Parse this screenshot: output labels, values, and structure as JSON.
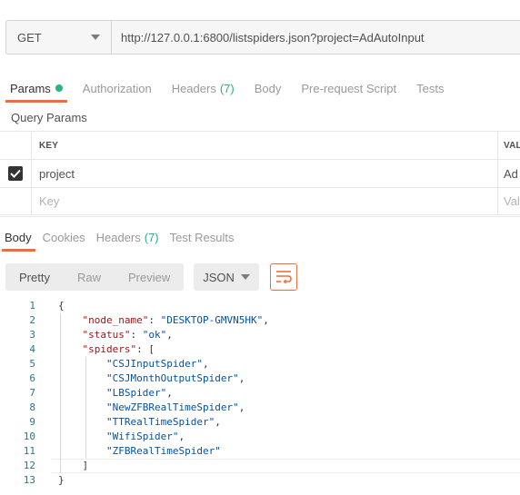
{
  "request": {
    "method": "GET",
    "url": "http://127.0.0.1:6800/listspiders.json?project=AdAutoInput"
  },
  "request_tabs": [
    {
      "label": "Params",
      "active": true,
      "dot": true
    },
    {
      "label": "Authorization"
    },
    {
      "label": "Headers",
      "count": "(7)"
    },
    {
      "label": "Body"
    },
    {
      "label": "Pre-request Script"
    },
    {
      "label": "Tests"
    }
  ],
  "query_params": {
    "title": "Query Params",
    "headers": {
      "key": "KEY",
      "value": "VAL"
    },
    "rows": [
      {
        "checked": true,
        "key": "project",
        "value": "Ad"
      }
    ],
    "placeholder": {
      "key": "Key",
      "value": "Val"
    }
  },
  "response_tabs": [
    {
      "label": "Body",
      "active": true
    },
    {
      "label": "Cookies"
    },
    {
      "label": "Headers",
      "count": "(7)"
    },
    {
      "label": "Test Results"
    }
  ],
  "response_toolbar": {
    "formats": [
      "Pretty",
      "Raw",
      "Preview"
    ],
    "active_format": "Pretty",
    "language": "JSON"
  },
  "code_lines": [
    {
      "n": "1",
      "text": "{"
    },
    {
      "n": "2",
      "text": "    \"node_name\": \"DESKTOP-GMVN5HK\","
    },
    {
      "n": "3",
      "text": "    \"status\": \"ok\","
    },
    {
      "n": "4",
      "text": "    \"spiders\": ["
    },
    {
      "n": "5",
      "text": "        \"CSJInputSpider\","
    },
    {
      "n": "6",
      "text": "        \"CSJMonthOutputSpider\","
    },
    {
      "n": "7",
      "text": "        \"LBSpider\","
    },
    {
      "n": "8",
      "text": "        \"NewZFBRealTimeSpider\","
    },
    {
      "n": "9",
      "text": "        \"TTRealTimeSpider\","
    },
    {
      "n": "10",
      "text": "        \"WifiSpider\","
    },
    {
      "n": "11",
      "text": "        \"ZFBRealTimeSpider\""
    },
    {
      "n": "12",
      "text": "    ]"
    },
    {
      "n": "13",
      "text": "}"
    }
  ],
  "colors": {
    "accent": "#f26b3a",
    "success": "#26b47f"
  }
}
